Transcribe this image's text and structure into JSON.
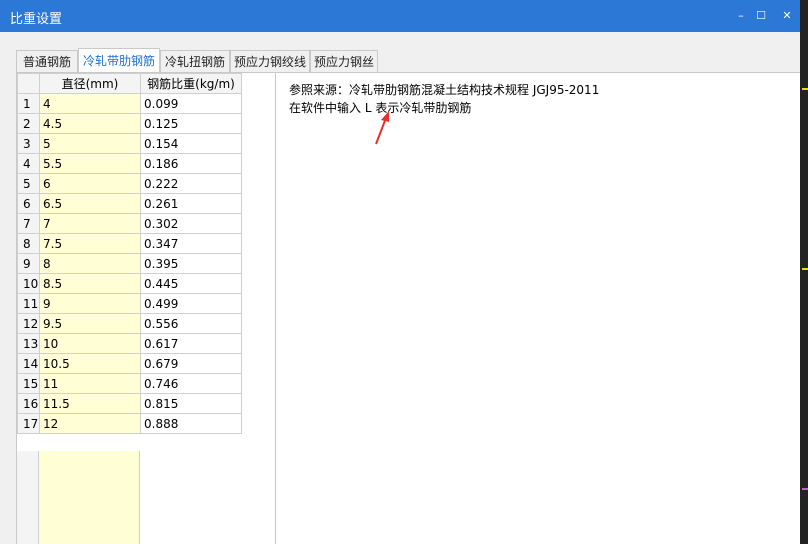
{
  "window": {
    "title": "比重设置",
    "controls": {
      "minimize": "–",
      "maximize": "☐",
      "close": "✕"
    }
  },
  "tabs": [
    "普通钢筋",
    "冷轧带肋钢筋",
    "冷轧扭钢筋",
    "预应力钢绞线",
    "预应力钢丝"
  ],
  "active_tab": "冷轧带肋钢筋",
  "table": {
    "columns": [
      "直径(mm)",
      "钢筋比重(kg/m)"
    ],
    "rows": [
      {
        "n": "1",
        "d": "4",
        "w": "0.099"
      },
      {
        "n": "2",
        "d": "4.5",
        "w": "0.125"
      },
      {
        "n": "3",
        "d": "5",
        "w": "0.154"
      },
      {
        "n": "4",
        "d": "5.5",
        "w": "0.186"
      },
      {
        "n": "5",
        "d": "6",
        "w": "0.222"
      },
      {
        "n": "6",
        "d": "6.5",
        "w": "0.261"
      },
      {
        "n": "7",
        "d": "7",
        "w": "0.302"
      },
      {
        "n": "8",
        "d": "7.5",
        "w": "0.347"
      },
      {
        "n": "9",
        "d": "8",
        "w": "0.395"
      },
      {
        "n": "10",
        "d": "8.5",
        "w": "0.445"
      },
      {
        "n": "11",
        "d": "9",
        "w": "0.499"
      },
      {
        "n": "12",
        "d": "9.5",
        "w": "0.556"
      },
      {
        "n": "13",
        "d": "10",
        "w": "0.617"
      },
      {
        "n": "14",
        "d": "10.5",
        "w": "0.679"
      },
      {
        "n": "15",
        "d": "11",
        "w": "0.746"
      },
      {
        "n": "16",
        "d": "11.5",
        "w": "0.815"
      },
      {
        "n": "17",
        "d": "12",
        "w": "0.888"
      }
    ]
  },
  "notes": {
    "source": "参照来源：冷轧带肋钢筋混凝土结构技术规程 JGJ95-2011",
    "hint": "在软件中输入 L 表示冷轧带肋钢筋"
  },
  "colors": {
    "titlebar": "#2b78d6",
    "active_tab_text": "#1e6fd0",
    "diameter_cell": "#fffed4",
    "annotation_arrow": "#e8302a"
  }
}
